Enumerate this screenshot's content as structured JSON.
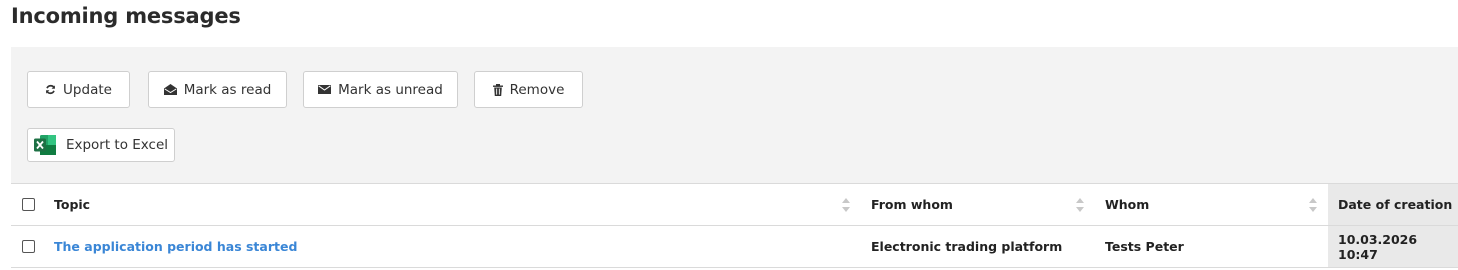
{
  "page": {
    "title": "Incoming messages"
  },
  "toolbar": {
    "update_label": "Update",
    "mark_read_label": "Mark as read",
    "mark_unread_label": "Mark as unread",
    "remove_label": "Remove",
    "export_label": "Export to Excel"
  },
  "table": {
    "headers": {
      "topic": "Topic",
      "from": "From whom",
      "whom": "Whom",
      "date": "Date of creation"
    },
    "rows": [
      {
        "topic": "The application period has started",
        "from": "Electronic trading platform",
        "whom": "Tests Peter",
        "date": "10.03.2026 10:47"
      }
    ]
  },
  "colors": {
    "link": "#3a86d6",
    "toolbar_bg": "#f3f3f3",
    "excel_green": "#1e7145",
    "sorted_col_bg": "#e9e9e9"
  },
  "icons": {
    "update": "refresh-icon",
    "mark_read": "envelope-open-icon",
    "mark_unread": "envelope-icon",
    "remove": "trash-icon",
    "export": "excel-icon",
    "sort": "sort-icon"
  }
}
